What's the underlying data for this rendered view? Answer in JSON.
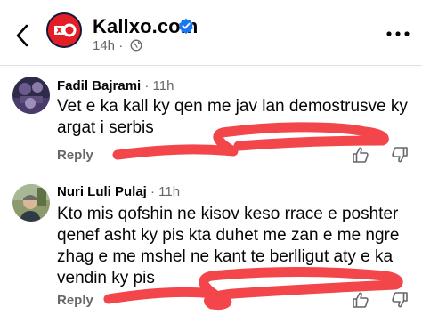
{
  "header": {
    "back_icon": "chevron-left-icon",
    "page_name": "Kallxo.com",
    "verified_icon": "verified-badge-icon",
    "post_time": "14h",
    "separator": "·",
    "audience_icon": "globe-icon",
    "more_icon": "more-horizontal-icon"
  },
  "comments": [
    {
      "author": "Fadil Bajrami",
      "time": "· 11h",
      "lines": [
        "Vet e ka kall ky qen me jav lan demostrusve ky",
        "argat i serbis"
      ],
      "reply_label": "Reply",
      "like_icon": "thumbs-up-icon",
      "dislike_icon": "thumbs-down-icon"
    },
    {
      "author": "Nuri Luli Pulaj",
      "time": "· 11h",
      "lines": [
        "Kto mis qofshin ne kisov keso rrace e poshter",
        "qenef asht ky pis kta duhet me zan e me ngre",
        "zhag e me mshel ne kant te berlligut aty e ka",
        "vendin ky pis"
      ],
      "reply_label": "Reply",
      "like_icon": "thumbs-up-icon",
      "dislike_icon": "thumbs-down-icon"
    }
  ],
  "colors": {
    "brand_red": "#e41e26",
    "verified_blue": "#1877f2",
    "scribble_red": "#f0262c",
    "meta_gray": "#65676b"
  }
}
